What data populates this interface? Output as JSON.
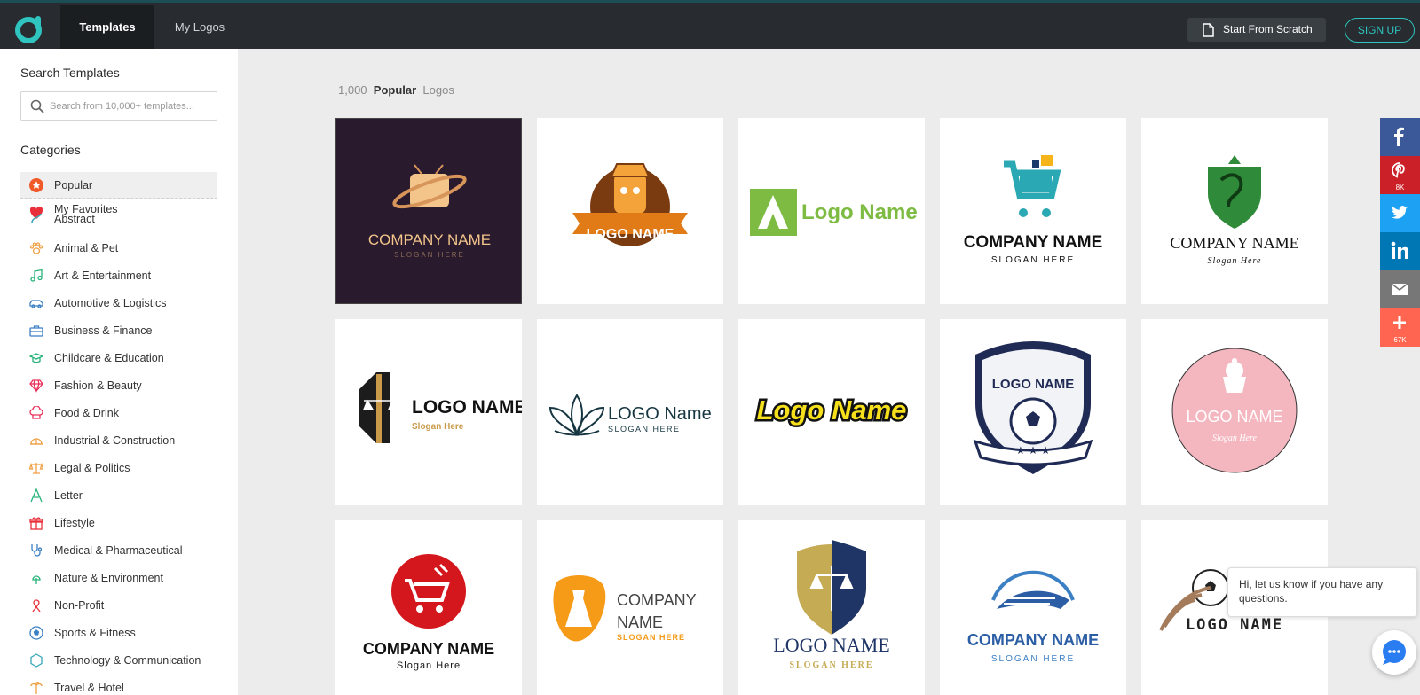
{
  "header": {
    "tabs": [
      {
        "label": "Templates"
      },
      {
        "label": "My Logos"
      }
    ],
    "start_from_scratch": "Start From Scratch",
    "sign_up": "SIGN UP"
  },
  "sidebar": {
    "search_heading": "Search Templates",
    "search_placeholder": "Search from 10,000+ templates...",
    "categories_heading": "Categories",
    "categories": [
      {
        "label": "Popular",
        "icon": "star-icon",
        "color": "#f05a28"
      },
      {
        "label": "My Favorites",
        "icon": "heart-icon",
        "color": "#e9303a"
      },
      {
        "label": "Abstract",
        "icon": "abstract-icon",
        "color": "#3aa7b8"
      },
      {
        "label": "Animal & Pet",
        "icon": "paw-icon",
        "color": "#f0a044"
      },
      {
        "label": "Art & Entertainment",
        "icon": "music-note-icon",
        "color": "#27b37a"
      },
      {
        "label": "Automotive & Logistics",
        "icon": "car-icon",
        "color": "#3b7fc4"
      },
      {
        "label": "Business & Finance",
        "icon": "briefcase-icon",
        "color": "#3b7fc4"
      },
      {
        "label": "Childcare & Education",
        "icon": "graduation-cap-icon",
        "color": "#27b37a"
      },
      {
        "label": "Fashion & Beauty",
        "icon": "diamond-icon",
        "color": "#e9305a"
      },
      {
        "label": "Food & Drink",
        "icon": "chef-hat-icon",
        "color": "#e9305a"
      },
      {
        "label": "Industrial & Construction",
        "icon": "hard-hat-icon",
        "color": "#f0a044"
      },
      {
        "label": "Legal & Politics",
        "icon": "scales-icon",
        "color": "#f0a044"
      },
      {
        "label": "Letter",
        "icon": "letter-a-icon",
        "color": "#27b37a"
      },
      {
        "label": "Lifestyle",
        "icon": "gift-icon",
        "color": "#e9303a"
      },
      {
        "label": "Medical & Pharmaceutical",
        "icon": "stethoscope-icon",
        "color": "#3b7fc4"
      },
      {
        "label": "Nature & Environment",
        "icon": "tree-icon",
        "color": "#27b37a"
      },
      {
        "label": "Non-Profit",
        "icon": "ribbon-icon",
        "color": "#e9303a"
      },
      {
        "label": "Sports & Fitness",
        "icon": "soccer-ball-icon",
        "color": "#3b7fc4"
      },
      {
        "label": "Technology & Communication",
        "icon": "hexagon-icon",
        "color": "#3aa7b8"
      },
      {
        "label": "Travel & Hotel",
        "icon": "palm-tree-icon",
        "color": "#f0a044"
      }
    ]
  },
  "main": {
    "count": "1,000",
    "count_bold": "Popular",
    "count_suffix": "Logos",
    "logos": [
      {
        "text": "COMPANY NAME",
        "slogan": "SLOGAN HERE",
        "icon": "tv-planet-icon"
      },
      {
        "text": "LOGO NAME",
        "icon": "cookie-mascot-icon"
      },
      {
        "text": "Logo Name",
        "icon": "triangle-a-icon"
      },
      {
        "text": "COMPANY NAME",
        "slogan": "SLOGAN HERE",
        "icon": "shopping-cart-icon"
      },
      {
        "text": "COMPANY NAME",
        "slogan": "Slogan Here",
        "icon": "dragon-shield-icon"
      },
      {
        "text": "LOGO NAME",
        "slogan": "Slogan Here",
        "icon": "law-pillar-icon"
      },
      {
        "text": "LOGO Name",
        "slogan": "SLOGAN HERE",
        "icon": "lotus-icon"
      },
      {
        "text": "Logo Name",
        "icon": "none"
      },
      {
        "text": "LOGO NAME",
        "icon": "soccer-shield-icon"
      },
      {
        "text": "LOGO NAME",
        "slogan": "Slogan Here",
        "icon": "cupcake-icon"
      },
      {
        "text": "COMPANY NAME",
        "slogan": "Slogan Here",
        "icon": "shopping-basket-icon"
      },
      {
        "text": "COMPANY",
        "text2": "NAME",
        "slogan": "SLOGAN HERE",
        "icon": "dress-icon"
      },
      {
        "text": "LOGO NAME",
        "slogan": "SLOGAN HERE",
        "icon": "law-shield-icon"
      },
      {
        "text": "COMPANY NAME",
        "slogan": "SLOGAN HERE",
        "icon": "speed-train-icon"
      },
      {
        "text": "LOGO NAME",
        "icon": "flying-ball-icon"
      }
    ]
  },
  "social": {
    "pinterest_count": "8K",
    "share_count": "67K"
  },
  "chat": {
    "message": "Hi, let us know if you have any questions."
  }
}
